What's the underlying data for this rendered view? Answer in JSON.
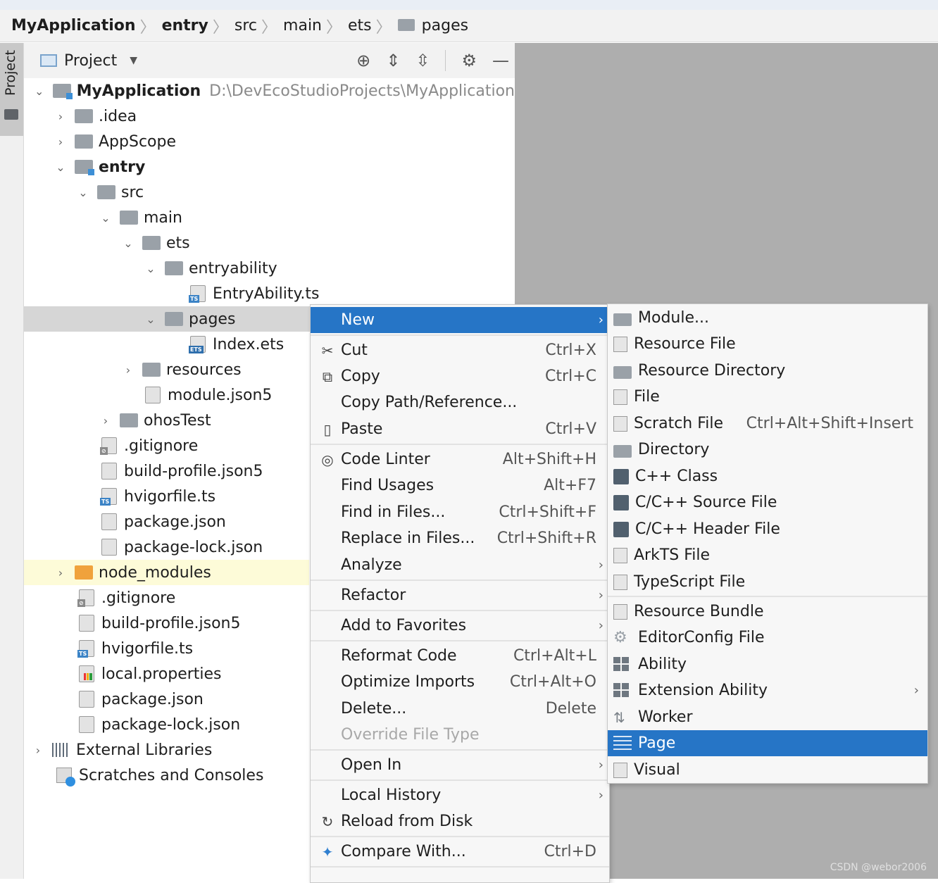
{
  "breadcrumb": {
    "items": [
      "MyApplication",
      "entry",
      "src",
      "main",
      "ets",
      "pages"
    ]
  },
  "toolwindow": {
    "tab_label": "Project"
  },
  "panel": {
    "title": "Project"
  },
  "tree": {
    "root": {
      "label": "MyApplication",
      "path": "D:\\DevEcoStudioProjects\\MyApplication"
    },
    "items": [
      ".idea",
      "AppScope",
      "entry",
      "src",
      "main",
      "ets",
      "entryability",
      "EntryAbility.ts",
      "pages",
      "Index.ets",
      "resources",
      "module.json5",
      "ohosTest",
      ".gitignore",
      "build-profile.json5",
      "hvigorfile.ts",
      "package.json",
      "package-lock.json",
      "node_modules",
      ".gitignore",
      "build-profile.json5",
      "hvigorfile.ts",
      "local.properties",
      "package.json",
      "package-lock.json",
      "External Libraries",
      "Scratches and Consoles"
    ]
  },
  "menu": {
    "items": [
      {
        "label": "New",
        "shortcut": ""
      },
      {
        "label": "Cut",
        "shortcut": "Ctrl+X"
      },
      {
        "label": "Copy",
        "shortcut": "Ctrl+C"
      },
      {
        "label": "Copy Path/Reference...",
        "shortcut": ""
      },
      {
        "label": "Paste",
        "shortcut": "Ctrl+V"
      },
      {
        "label": "Code Linter",
        "shortcut": "Alt+Shift+H"
      },
      {
        "label": "Find Usages",
        "shortcut": "Alt+F7"
      },
      {
        "label": "Find in Files...",
        "shortcut": "Ctrl+Shift+F"
      },
      {
        "label": "Replace in Files...",
        "shortcut": "Ctrl+Shift+R"
      },
      {
        "label": "Analyze",
        "shortcut": ""
      },
      {
        "label": "Refactor",
        "shortcut": ""
      },
      {
        "label": "Add to Favorites",
        "shortcut": ""
      },
      {
        "label": "Reformat Code",
        "shortcut": "Ctrl+Alt+L"
      },
      {
        "label": "Optimize Imports",
        "shortcut": "Ctrl+Alt+O"
      },
      {
        "label": "Delete...",
        "shortcut": "Delete"
      },
      {
        "label": "Override File Type",
        "shortcut": ""
      },
      {
        "label": "Open In",
        "shortcut": ""
      },
      {
        "label": "Local History",
        "shortcut": ""
      },
      {
        "label": "Reload from Disk",
        "shortcut": ""
      },
      {
        "label": "Compare With...",
        "shortcut": "Ctrl+D"
      }
    ]
  },
  "submenu": {
    "items": [
      {
        "label": "Module...",
        "shortcut": ""
      },
      {
        "label": "Resource File",
        "shortcut": ""
      },
      {
        "label": "Resource Directory",
        "shortcut": ""
      },
      {
        "label": "File",
        "shortcut": ""
      },
      {
        "label": "Scratch File",
        "shortcut": "Ctrl+Alt+Shift+Insert"
      },
      {
        "label": "Directory",
        "shortcut": ""
      },
      {
        "label": "C++ Class",
        "shortcut": ""
      },
      {
        "label": "C/C++ Source File",
        "shortcut": ""
      },
      {
        "label": "C/C++ Header File",
        "shortcut": ""
      },
      {
        "label": "ArkTS File",
        "shortcut": ""
      },
      {
        "label": "TypeScript File",
        "shortcut": ""
      },
      {
        "label": "Resource Bundle",
        "shortcut": ""
      },
      {
        "label": "EditorConfig File",
        "shortcut": ""
      },
      {
        "label": "Ability",
        "shortcut": ""
      },
      {
        "label": "Extension Ability",
        "shortcut": ""
      },
      {
        "label": "Worker",
        "shortcut": ""
      },
      {
        "label": "Page",
        "shortcut": ""
      },
      {
        "label": "Visual",
        "shortcut": ""
      }
    ]
  },
  "colors": {
    "selection": "#2675c6",
    "tree_selection": "#d6d6d6",
    "folder": "#9aa1a8",
    "node_modules_folder": "#f0a23c"
  },
  "watermark": "CSDN @webor2006"
}
